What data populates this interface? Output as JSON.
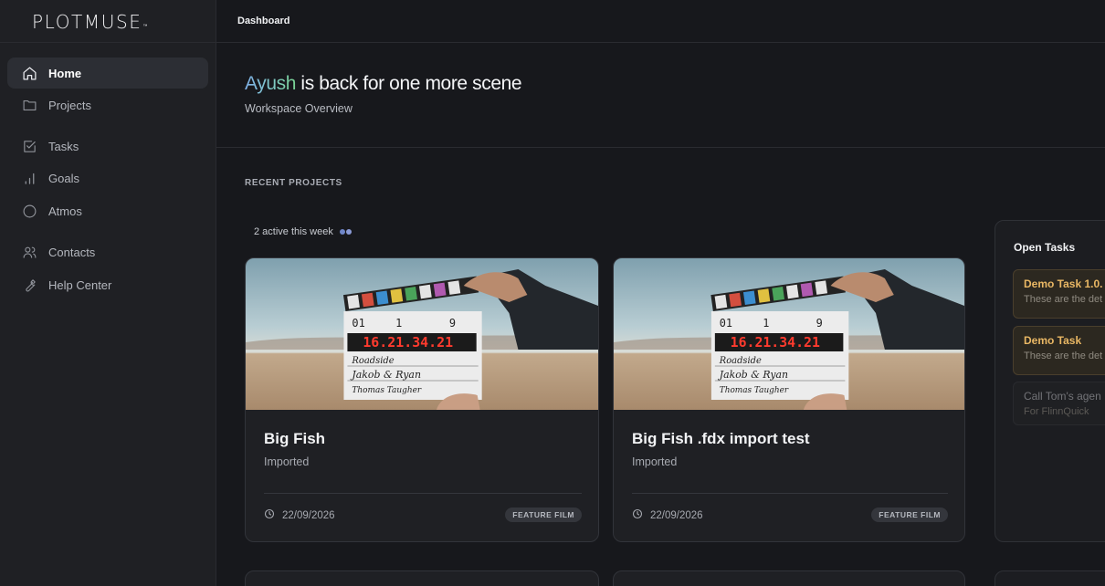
{
  "app": {
    "logo_text": "PLOTMUSE",
    "logo_tm": "™"
  },
  "topbar": {
    "breadcrumb": "Dashboard"
  },
  "sidebar": {
    "items": [
      {
        "label": "Home",
        "icon": "home-icon",
        "active": true
      },
      {
        "label": "Projects",
        "icon": "folder-icon"
      },
      {
        "label": "Tasks",
        "icon": "checkbox-icon"
      },
      {
        "label": "Goals",
        "icon": "bar-chart-icon"
      },
      {
        "label": "Atmos",
        "icon": "circle-icon"
      },
      {
        "label": "Contacts",
        "icon": "users-icon"
      },
      {
        "label": "Help Center",
        "icon": "wrench-icon"
      }
    ]
  },
  "hero": {
    "name": "Ayush",
    "greeting_rest": " is back for one more scene",
    "subtitle": "Workspace Overview"
  },
  "recent": {
    "label": "RECENT PROJECTS",
    "active_note": "2 active this week"
  },
  "projects": [
    {
      "title": "Big Fish",
      "status": "Imported",
      "date": "22/09/2026",
      "badge": "FEATURE FILM"
    },
    {
      "title": "Big Fish .fdx import test",
      "status": "Imported",
      "date": "22/09/2026",
      "badge": "FEATURE FILM"
    }
  ],
  "tasks_panel": {
    "title": "Open Tasks",
    "tasks": [
      {
        "title": "Demo Task 1.0.",
        "desc": "These are the det"
      },
      {
        "title": "Demo Task",
        "desc": "These are the det"
      },
      {
        "title": "Call Tom's agen",
        "desc": "For FlinnQuick"
      }
    ]
  },
  "thumb": {
    "slate_roll": "01",
    "slate_scene": "1",
    "slate_take": "9",
    "timecode": "16.21.34.21",
    "slate_line1": "Roadside",
    "slate_line2": "Jakob & Ryan",
    "slate_line3": "Thomas Taugher"
  },
  "colors": {
    "accent_name_start": "#7fb0e8",
    "accent_name_end": "#79d392",
    "task_title": "#e9b764"
  }
}
